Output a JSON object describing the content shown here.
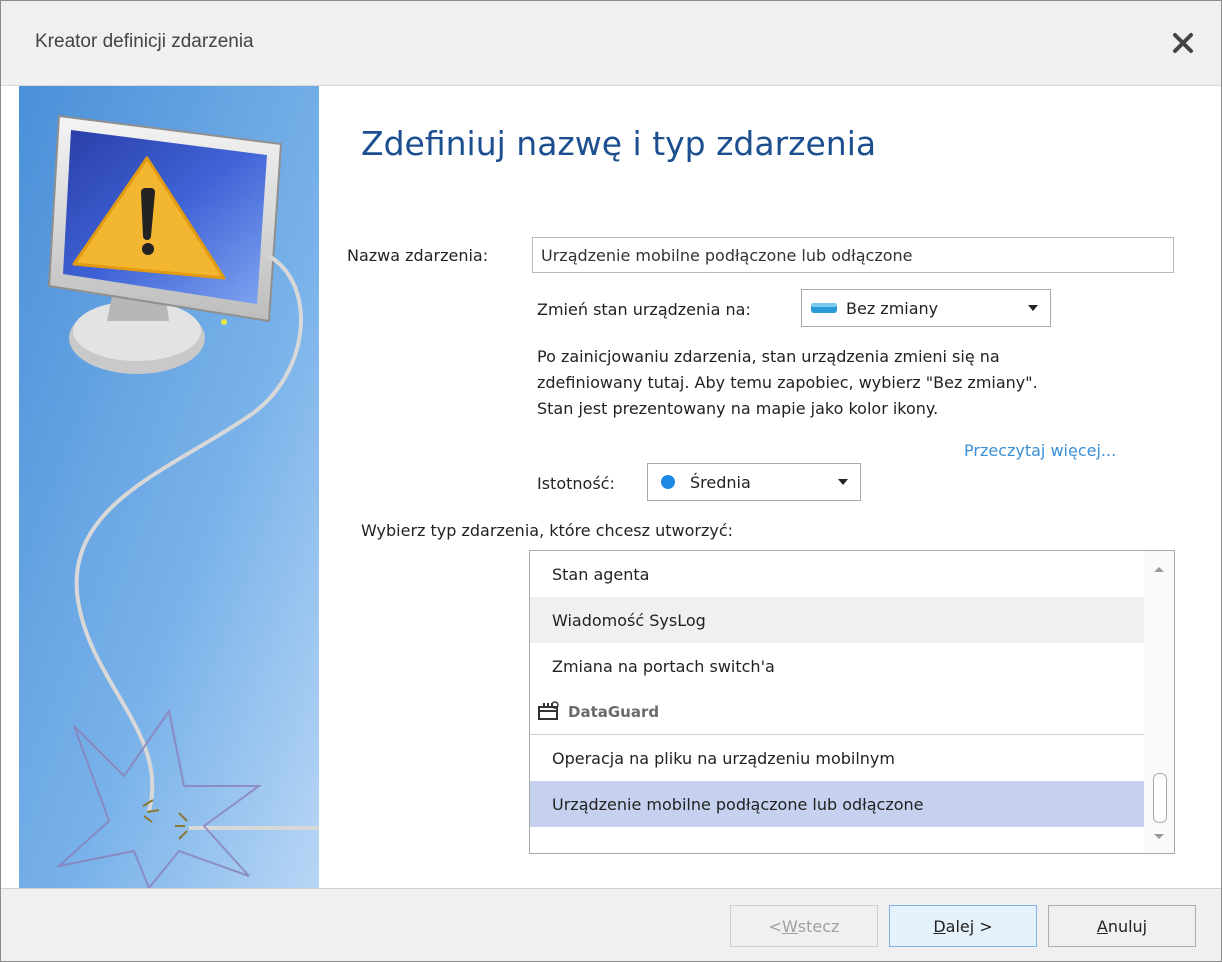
{
  "window": {
    "title": "Kreator definicji zdarzenia",
    "close_glyph": "✕"
  },
  "page": {
    "heading": "Zdefiniuj nazwę i typ zdarzenia",
    "name_label": "Nazwa zdarzenia:",
    "name_value": "Urządzenie mobilne podłączone lub odłączone",
    "state_label": "Zmień stan urządzenia na:",
    "state_value": "Bez zmiany",
    "state_icon": "device-state-icon",
    "state_icon_color": "#2a9ad8",
    "description_lines": [
      "Po zainicjowaniu zdarzenia, stan urządzenia zmieni się na",
      "zdefiniowany tutaj. Aby temu zapobiec, wybierz \"Bez zmiany\".",
      "Stan jest prezentowany na mapie jako kolor ikony."
    ],
    "read_more": "Przeczytaj więcej...",
    "severity_label": "Istotność:",
    "severity_value": "Średnia",
    "severity_color": "#1e88e5",
    "event_type_label": "Wybierz typ zdarzenia, które chcesz utworzyć:"
  },
  "list": {
    "items": [
      {
        "label": "Stan agenta"
      },
      {
        "label": "Wiadomość SysLog"
      },
      {
        "label": "Zmiana na portach switch'a"
      }
    ],
    "group": {
      "label": "DataGuard",
      "icon": "dataguard-icon"
    },
    "group_items": [
      {
        "label": "Operacja na pliku na urządzeniu mobilnym"
      },
      {
        "label": "Urządzenie mobilne podłączone lub odłączone"
      }
    ],
    "hover_color": "#f0f0f0",
    "selected_color": "#c5d1ef"
  },
  "buttons": {
    "back": {
      "prefix": "< ",
      "mnemonic": "W",
      "rest": "stecz"
    },
    "next": {
      "mnemonic": "D",
      "rest": "alej >"
    },
    "cancel": {
      "mnemonic": "A",
      "rest": "nuluj"
    }
  }
}
